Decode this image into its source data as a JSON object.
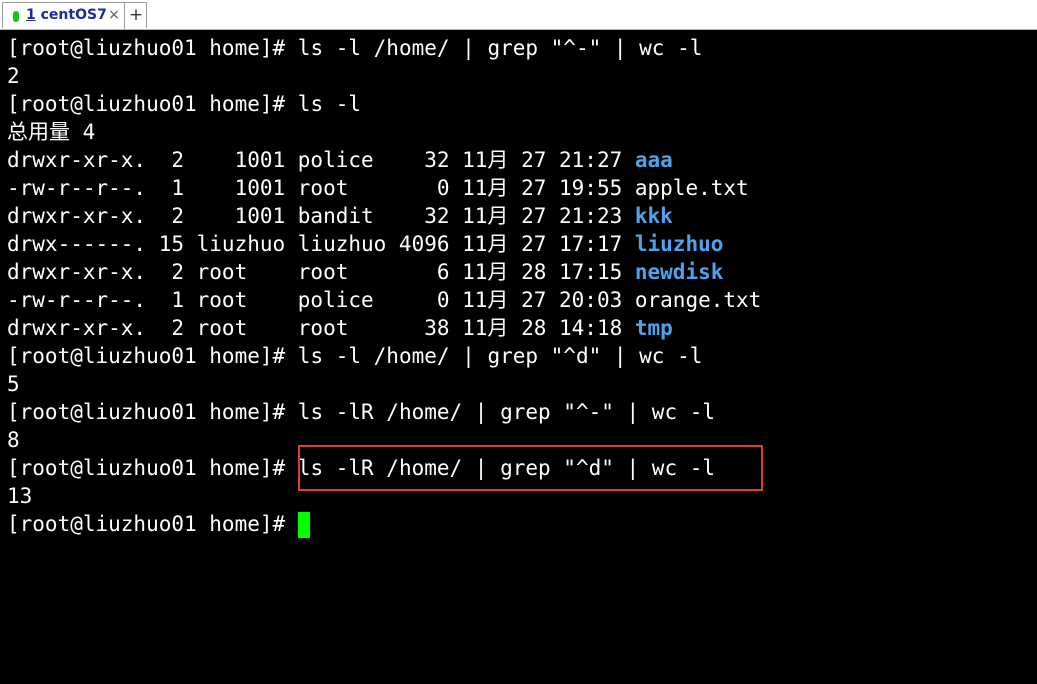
{
  "tabbar": {
    "tab": {
      "number": "1",
      "title": "centOS7",
      "close": "×",
      "status_color": "#14c414"
    },
    "add_tab": "+"
  },
  "terminal": {
    "prompt": "[root@liuzhuo01 home]# ",
    "lines": [
      {
        "type": "cmd",
        "text": "ls -l /home/ | grep \"^-\" | wc -l"
      },
      {
        "type": "out",
        "text": "2"
      },
      {
        "type": "cmd",
        "text": "ls -l"
      },
      {
        "type": "out",
        "text": "总用量 4"
      },
      {
        "type": "ls",
        "meta": "drwxr-xr-x.  2    1001 police    32 11月 27 21:27 ",
        "name": "aaa",
        "dir": true
      },
      {
        "type": "ls",
        "meta": "-rw-r--r--.  1    1001 root       0 11月 27 19:55 ",
        "name": "apple.txt",
        "dir": false
      },
      {
        "type": "ls",
        "meta": "drwxr-xr-x.  2    1001 bandit    32 11月 27 21:23 ",
        "name": "kkk",
        "dir": true
      },
      {
        "type": "ls",
        "meta": "drwx------. 15 liuzhuo liuzhuo 4096 11月 27 17:17 ",
        "name": "liuzhuo",
        "dir": true
      },
      {
        "type": "ls",
        "meta": "drwxr-xr-x.  2 root    root       6 11月 28 17:15 ",
        "name": "newdisk",
        "dir": true
      },
      {
        "type": "ls",
        "meta": "-rw-r--r--.  1 root    police     0 11月 27 20:03 ",
        "name": "orange.txt",
        "dir": false
      },
      {
        "type": "ls",
        "meta": "drwxr-xr-x.  2 root    root      38 11月 28 14:18 ",
        "name": "tmp",
        "dir": true
      },
      {
        "type": "cmd",
        "text": "ls -l /home/ | grep \"^d\" | wc -l"
      },
      {
        "type": "out",
        "text": "5"
      },
      {
        "type": "cmd",
        "text": "ls -lR /home/ | grep \"^-\" | wc -l"
      },
      {
        "type": "out",
        "text": "8"
      },
      {
        "type": "cmd",
        "text": "ls -lR /home/ | grep \"^d\" | wc -l",
        "highlighted": true
      },
      {
        "type": "out",
        "text": "13"
      },
      {
        "type": "cmd",
        "text": "",
        "cursor": true
      }
    ],
    "colors": {
      "background": "#000000",
      "text": "#ffffff",
      "directory": "#4fa3ee",
      "cursor": "#00ff00",
      "highlight_border": "#e43838"
    }
  }
}
